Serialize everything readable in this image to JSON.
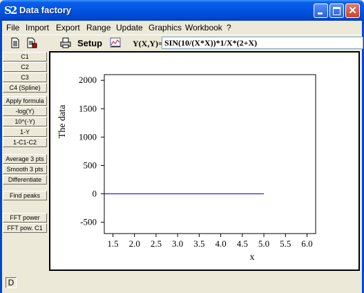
{
  "window": {
    "title": "Data factory",
    "app_icon_text": "S2"
  },
  "menu": [
    "File",
    "Import",
    "Export",
    "Range",
    "Update",
    "Graphics",
    "Workbook",
    "?"
  ],
  "toolbar": {
    "setup_label": "Setup",
    "formula_label": "Y(X,Y)=",
    "formula_value": "SIN(10/(X*X))*1/X*(2+X)"
  },
  "side_buttons": [
    "C1",
    "C2",
    "C3",
    "C4 (Spline)",
    "Apply formula",
    "-log(Y)",
    "10^(-Y)",
    "1-Y",
    "1-C1-C2",
    "Average 3 pts",
    "Smooth 3 pts",
    "Differentiate",
    "Find peaks",
    "FFT power",
    "FFT pow. C1"
  ],
  "status": {
    "indicator": "D"
  },
  "colors": {
    "series": "#0000c8",
    "titlebar": "#0054e3"
  },
  "icons": [
    "new-document-icon",
    "save-document-icon",
    "printer-icon",
    "chart-icon"
  ],
  "chart_data": {
    "type": "line",
    "xlabel": "x",
    "ylabel": "The data",
    "xlim": [
      1.3,
      6.2
    ],
    "ylim": [
      -700,
      2100
    ],
    "x_ticks": [
      "1.5",
      "2.0",
      "2.5",
      "3.0",
      "3.5",
      "4.0",
      "4.5",
      "5.0",
      "5.5",
      "6.0"
    ],
    "y_ticks": [
      "2000",
      "1500",
      "1000",
      "500",
      "0",
      "-500"
    ],
    "series": [
      {
        "x": [
          1.3,
          5.0
        ],
        "y": [
          0,
          0
        ],
        "color": "#0000c8"
      }
    ]
  }
}
